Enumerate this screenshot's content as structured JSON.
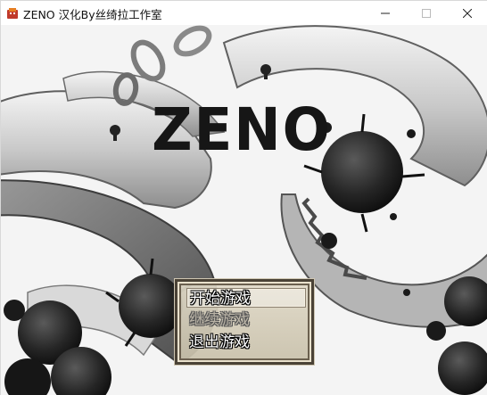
{
  "window": {
    "title": "ZENO 汉化By丝绮拉工作室",
    "icon": "game-app-icon",
    "controls": [
      "minimize",
      "maximize",
      "close"
    ]
  },
  "game": {
    "logo": "ZENO"
  },
  "menu": {
    "items": [
      {
        "label": "开始游戏",
        "state": "selected"
      },
      {
        "label": "继续游戏",
        "state": "disabled"
      },
      {
        "label": "退出游戏",
        "state": "enabled"
      }
    ]
  },
  "colors": {
    "menu_frame": "#4a4236",
    "menu_fill": "#d8d0bb",
    "logo": "#161616",
    "ink": "#141414"
  }
}
